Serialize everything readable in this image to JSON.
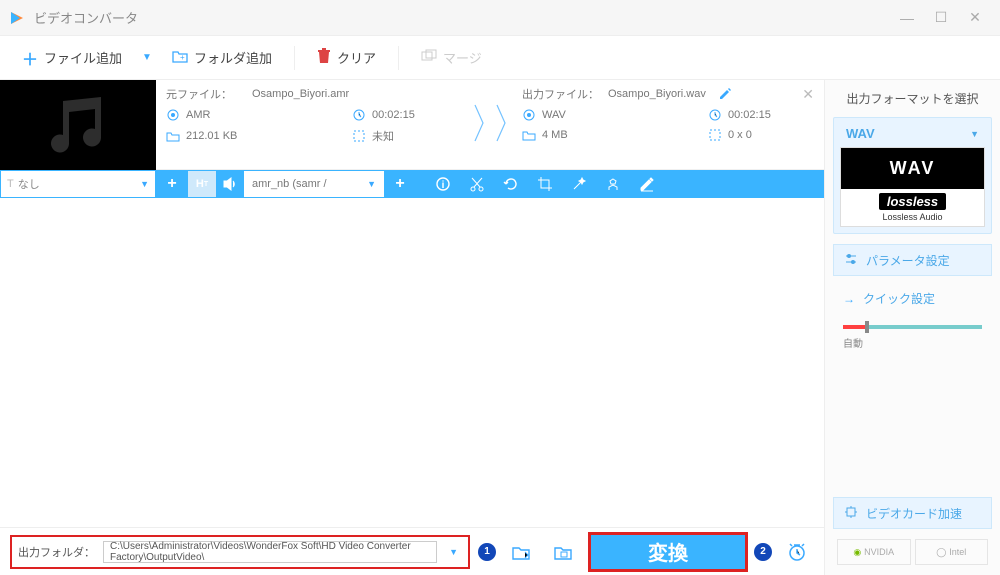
{
  "window": {
    "title": "ビデオコンバータ"
  },
  "toolbar": {
    "add_file": "ファイル追加",
    "add_folder": "フォルダ追加",
    "clear": "クリア",
    "merge": "マージ"
  },
  "item": {
    "src_label": "元ファイル：",
    "src_name": "Osampo_Biyori.amr",
    "out_label": "出力ファイル：",
    "out_name": "Osampo_Biyori.wav",
    "src_codec": "AMR",
    "src_dur": "00:02:15",
    "src_size": "212.01 KB",
    "src_dim": "未知",
    "out_codec": "WAV",
    "out_dur": "00:02:15",
    "out_size": "4 MB",
    "out_dim": "0 x 0",
    "subtitle": "なし",
    "audio_track": "amr_nb (samr /"
  },
  "right": {
    "title": "出力フォーマットを選択",
    "fmt": "WAV",
    "fmt_big": "WAV",
    "lossless_logo": "lossless",
    "lossless_txt": "Lossless Audio",
    "params": "パラメータ設定",
    "quick": "クイック設定",
    "auto": "自動",
    "gpu": "ビデオカード加速",
    "nvidia": "NVIDIA",
    "intel": "Intel"
  },
  "footer": {
    "out_label": "出力フォルダ：",
    "out_path": "C:\\Users\\Administrator\\Videos\\WonderFox Soft\\HD Video Converter Factory\\OutputVideo\\",
    "convert": "変換",
    "badge1": "1",
    "badge2": "2"
  }
}
